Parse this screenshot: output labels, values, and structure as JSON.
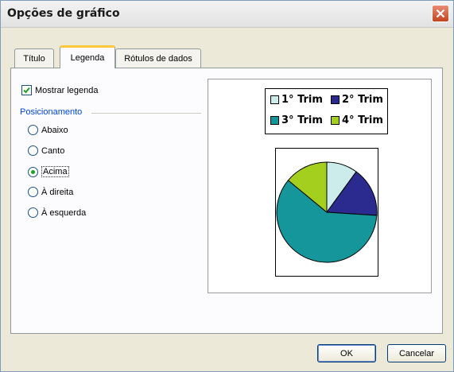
{
  "window": {
    "title": "Opções de gráfico",
    "close_icon": "close-icon"
  },
  "tabs": [
    {
      "label": "Título",
      "active": false
    },
    {
      "label": "Legenda",
      "active": true
    },
    {
      "label": "Rótulos de dados",
      "active": false
    }
  ],
  "legend_tab": {
    "show_legend_label": "Mostrar legenda",
    "show_legend_checked": true,
    "placement_group_label": "Posicionamento",
    "placement_options": [
      {
        "label": "Abaixo",
        "selected": false
      },
      {
        "label": "Canto",
        "selected": false
      },
      {
        "label": "Acima",
        "selected": true
      },
      {
        "label": "À direita",
        "selected": false
      },
      {
        "label": "À esquerda",
        "selected": false
      }
    ]
  },
  "preview": {
    "legend_position": "top",
    "chart_data": {
      "type": "pie",
      "categories": [
        "1° Trim",
        "2° Trim",
        "3° Trim",
        "4° Trim"
      ],
      "values": [
        10,
        16,
        60,
        14
      ],
      "colors": [
        "#ccecec",
        "#2b2b8f",
        "#14969a",
        "#a5cf1e"
      ]
    }
  },
  "buttons": {
    "ok": "OK",
    "cancel": "Cancelar"
  },
  "colors": {
    "dialog_bg": "#ece9d8",
    "close_button": "#c4441f",
    "active_tab_accent": "#ffc83c",
    "group_label": "#0046d5"
  }
}
